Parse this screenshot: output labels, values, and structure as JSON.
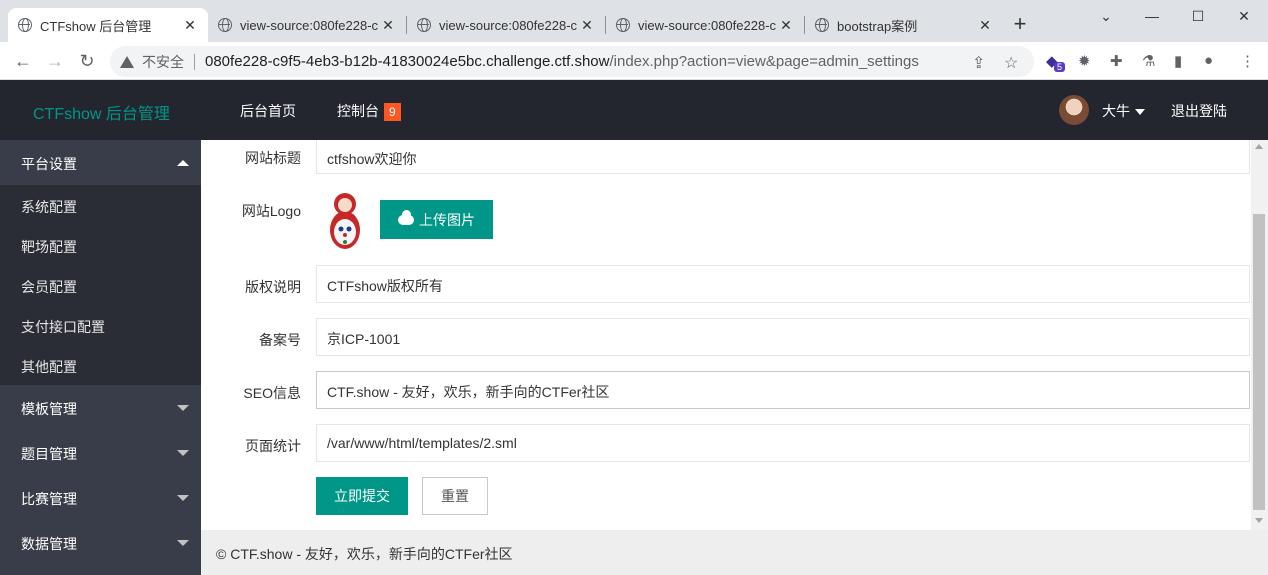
{
  "browser": {
    "tabs": [
      {
        "title": "CTFshow 后台管理",
        "active": true
      },
      {
        "title": "view-source:080fe228-c",
        "active": false
      },
      {
        "title": "view-source:080fe228-c",
        "active": false
      },
      {
        "title": "view-source:080fe228-c",
        "active": false
      },
      {
        "title": "bootstrap案例",
        "active": false
      }
    ],
    "security_label": "不安全",
    "url_host": "080fe228-c9f5-4eb3-b12b-41830024e5bc.challenge.ctf.show",
    "url_path": "/index.php?action=view&page=admin_settings",
    "extension_badge": "5"
  },
  "header": {
    "brand": "CTFshow 后台管理",
    "nav_home": "后台首页",
    "nav_console": "控制台",
    "console_badge": "9",
    "username": "大牛",
    "logout": "退出登陆"
  },
  "sidebar": {
    "groups": [
      {
        "label": "平台设置",
        "expanded": true,
        "items": [
          "系统配置",
          "靶场配置",
          "会员配置",
          "支付接口配置",
          "其他配置"
        ]
      },
      {
        "label": "模板管理",
        "expanded": false
      },
      {
        "label": "题目管理",
        "expanded": false
      },
      {
        "label": "比赛管理",
        "expanded": false
      },
      {
        "label": "数据管理",
        "expanded": false
      }
    ]
  },
  "form": {
    "site_title": {
      "label": "网站标题",
      "value": "ctfshow欢迎你"
    },
    "site_logo": {
      "label": "网站Logo",
      "upload_button": "上传图片"
    },
    "copyright": {
      "label": "版权说明",
      "value": "CTFshow版权所有"
    },
    "icp": {
      "label": "备案号",
      "value": "京ICP-1001"
    },
    "seo": {
      "label": "SEO信息",
      "value": "CTF.show - 友好，欢乐，新手向的CTFer社区"
    },
    "stats": {
      "label": "页面统计",
      "value": "/var/www/html/templates/2.sml"
    },
    "submit": "立即提交",
    "reset": "重置"
  },
  "footer": {
    "text": "© CTF.show - 友好，欢乐，新手向的CTFer社区"
  },
  "colors": {
    "accent": "#009688",
    "header_bg": "#23262e",
    "sidebar_bg": "#393d49",
    "badge": "#ff5722"
  }
}
